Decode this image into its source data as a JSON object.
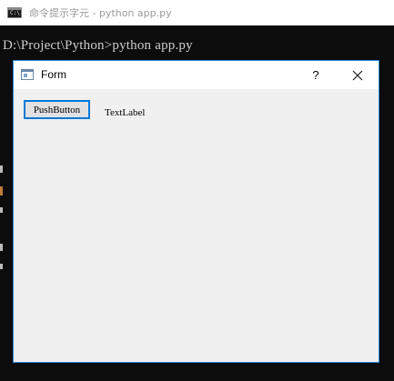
{
  "console": {
    "title": "命令提示字元 - python  app.py",
    "icon_text": "C:\\",
    "line": "D:\\Project\\Python>python app.py"
  },
  "form": {
    "title": "Form",
    "help_label": "?",
    "push_button_label": "PushButton",
    "text_label": "TextLabel"
  },
  "colors": {
    "accent": "#0078d7",
    "window_border": "#2b88d8",
    "console_bg": "#0c0c0c",
    "form_bg": "#f0f0f0"
  },
  "icons": {
    "console": "console-icon",
    "form": "form-window-icon",
    "close": "close-icon"
  }
}
